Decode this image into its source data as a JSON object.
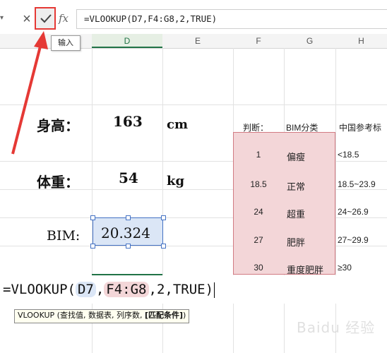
{
  "formula_bar": {
    "formula": "=VLOOKUP(D7,F4:G8,2,TRUE)",
    "fx_label": "fx",
    "cancel_glyph": "×",
    "enter_tooltip": "输入"
  },
  "columns": [
    "D",
    "E",
    "F",
    "G",
    "H"
  ],
  "labels": {
    "height_label": "身高：",
    "height_value": "163",
    "height_unit": "cm",
    "weight_label": "体重：",
    "weight_value": "54",
    "weight_unit": "kg",
    "bmi_label": "BIM:",
    "bmi_value": "20.324"
  },
  "lookup_table": {
    "headers": [
      "判断：",
      "BIM分类",
      "中国参考标"
    ],
    "rows": [
      {
        "threshold": "1",
        "category": "偏瘦",
        "reference": "<18.5"
      },
      {
        "threshold": "18.5",
        "category": "正常",
        "reference": "18.5~23.9"
      },
      {
        "threshold": "24",
        "category": "超重",
        "reference": "24~26.9"
      },
      {
        "threshold": "27",
        "category": "肥胖",
        "reference": "27~29.9"
      },
      {
        "threshold": "30",
        "category": "重度肥胖",
        "reference": "≥30"
      }
    ]
  },
  "edit": {
    "prefix": "=VLOOKUP(",
    "ref1": "D7",
    "sep1": ",",
    "ref2": "F4:G8",
    "suffix": ",2,TRUE)"
  },
  "func_hint": {
    "text": "VLOOKUP (查找值, 数据表, 列序数, ",
    "bold": "[匹配条件]",
    "close": ")"
  },
  "watermark": "Baidu 经验",
  "colors": {
    "enter_highlight": "#e53935",
    "range_fill": "#f3d6d8",
    "ref_fill": "#dbe6f6",
    "selection": "#217346"
  }
}
